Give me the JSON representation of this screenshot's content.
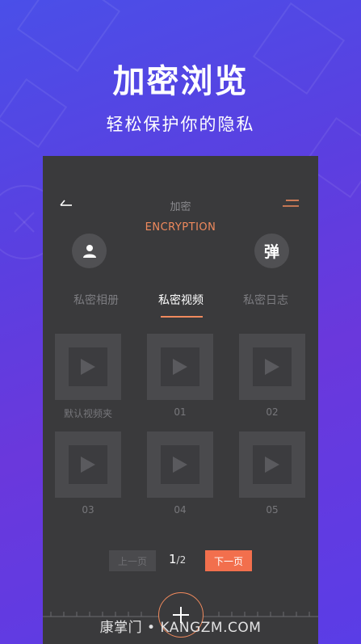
{
  "promo": {
    "headline": "加密浏览",
    "subline": "轻松保护你的隐私"
  },
  "header": {
    "title": "加密",
    "subtitle": "ENCRYPTION",
    "danmu_label": "弹"
  },
  "tabs": [
    {
      "label": "私密相册",
      "active": false
    },
    {
      "label": "私密视频",
      "active": true
    },
    {
      "label": "私密日志",
      "active": false
    }
  ],
  "videos": [
    {
      "label": "默认视频夹"
    },
    {
      "label": "01"
    },
    {
      "label": "02"
    },
    {
      "label": "03"
    },
    {
      "label": "04"
    },
    {
      "label": "05"
    }
  ],
  "pager": {
    "prev_label": "上一页",
    "current": "1",
    "total": "/2",
    "next_label": "下一页"
  },
  "watermark": "康掌门 • KANGZM.COM",
  "colors": {
    "accent": "#f08a5d",
    "next_button": "#f26f4d",
    "panel": "#3a3a3c"
  },
  "icons": {
    "back": "back-arrow-icon",
    "menu": "hamburger-icon",
    "avatar": "user-icon",
    "play": "play-icon",
    "add": "plus-icon"
  }
}
